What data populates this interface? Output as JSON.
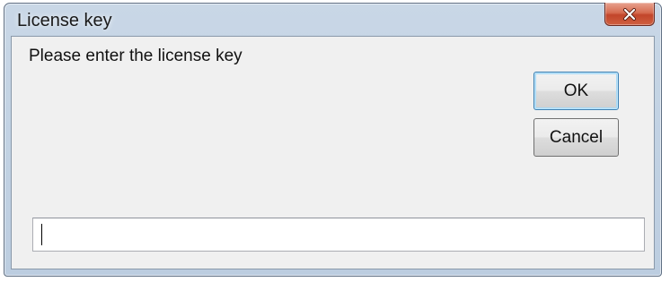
{
  "window": {
    "title": "License key",
    "close_icon": "close-x-icon"
  },
  "dialog": {
    "prompt": "Please enter the license key",
    "ok_label": "OK",
    "cancel_label": "Cancel",
    "key_value": ""
  },
  "colors": {
    "close_button": "#c7492d",
    "client_background": "#f0f0f0",
    "frame": "#c3d3e4",
    "default_button_border": "#3c7fb1"
  }
}
